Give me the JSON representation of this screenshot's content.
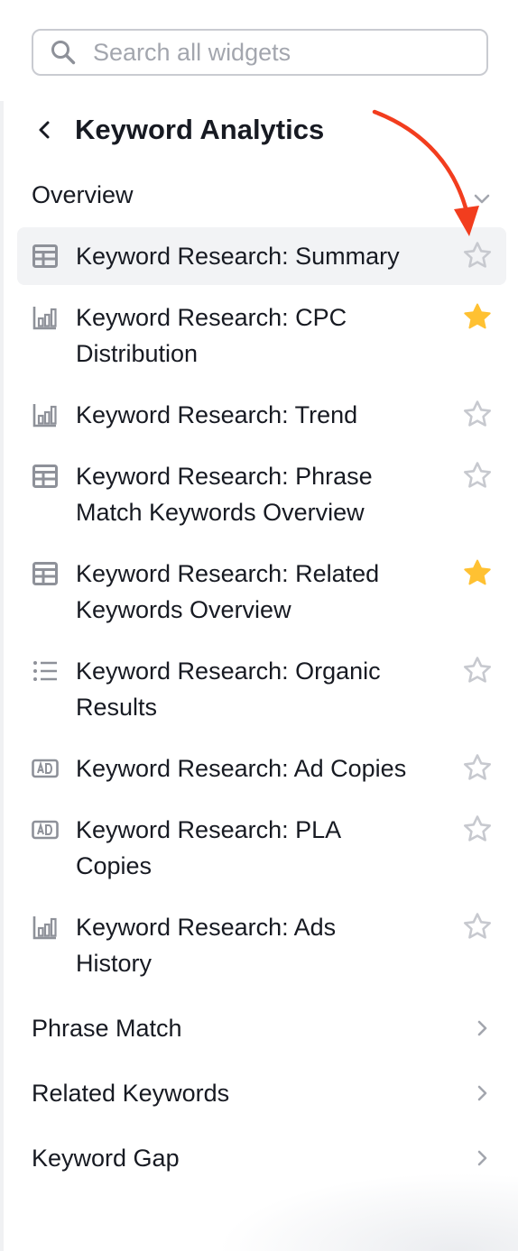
{
  "search": {
    "placeholder": "Search all widgets"
  },
  "header": {
    "title": "Keyword Analytics"
  },
  "sections": {
    "overview": "Overview",
    "phrase_match": "Phrase Match",
    "related_keywords": "Related Keywords",
    "keyword_gap": "Keyword Gap"
  },
  "items": [
    {
      "line1": "Keyword Research: Summary",
      "line2": "",
      "icon": "table-icon",
      "favorite": false
    },
    {
      "line1": "Keyword Research: CPC",
      "line2": "Distribution",
      "icon": "bar-chart-icon",
      "favorite": true
    },
    {
      "line1": "Keyword Research: Trend",
      "line2": "",
      "icon": "bar-chart-icon",
      "favorite": false
    },
    {
      "line1": "Keyword Research: Phrase",
      "line2": "Match Keywords Overview",
      "icon": "table-icon",
      "favorite": false
    },
    {
      "line1": "Keyword Research: Related",
      "line2": "Keywords Overview",
      "icon": "table-icon",
      "favorite": true
    },
    {
      "line1": "Keyword Research: Organic",
      "line2": "Results",
      "icon": "list-icon",
      "favorite": false
    },
    {
      "line1": "Keyword Research: Ad Copies",
      "line2": "",
      "icon": "ad-icon",
      "favorite": false
    },
    {
      "line1": "Keyword Research: PLA",
      "line2": "Copies",
      "icon": "ad-icon",
      "favorite": false
    },
    {
      "line1": "Keyword Research: Ads",
      "line2": "History",
      "icon": "bar-chart-icon",
      "favorite": false
    }
  ],
  "colors": {
    "star_filled": "#ffc132",
    "star_outline": "#c7c9cf",
    "arrow": "#f23d1e",
    "icon": "#8e9199"
  }
}
